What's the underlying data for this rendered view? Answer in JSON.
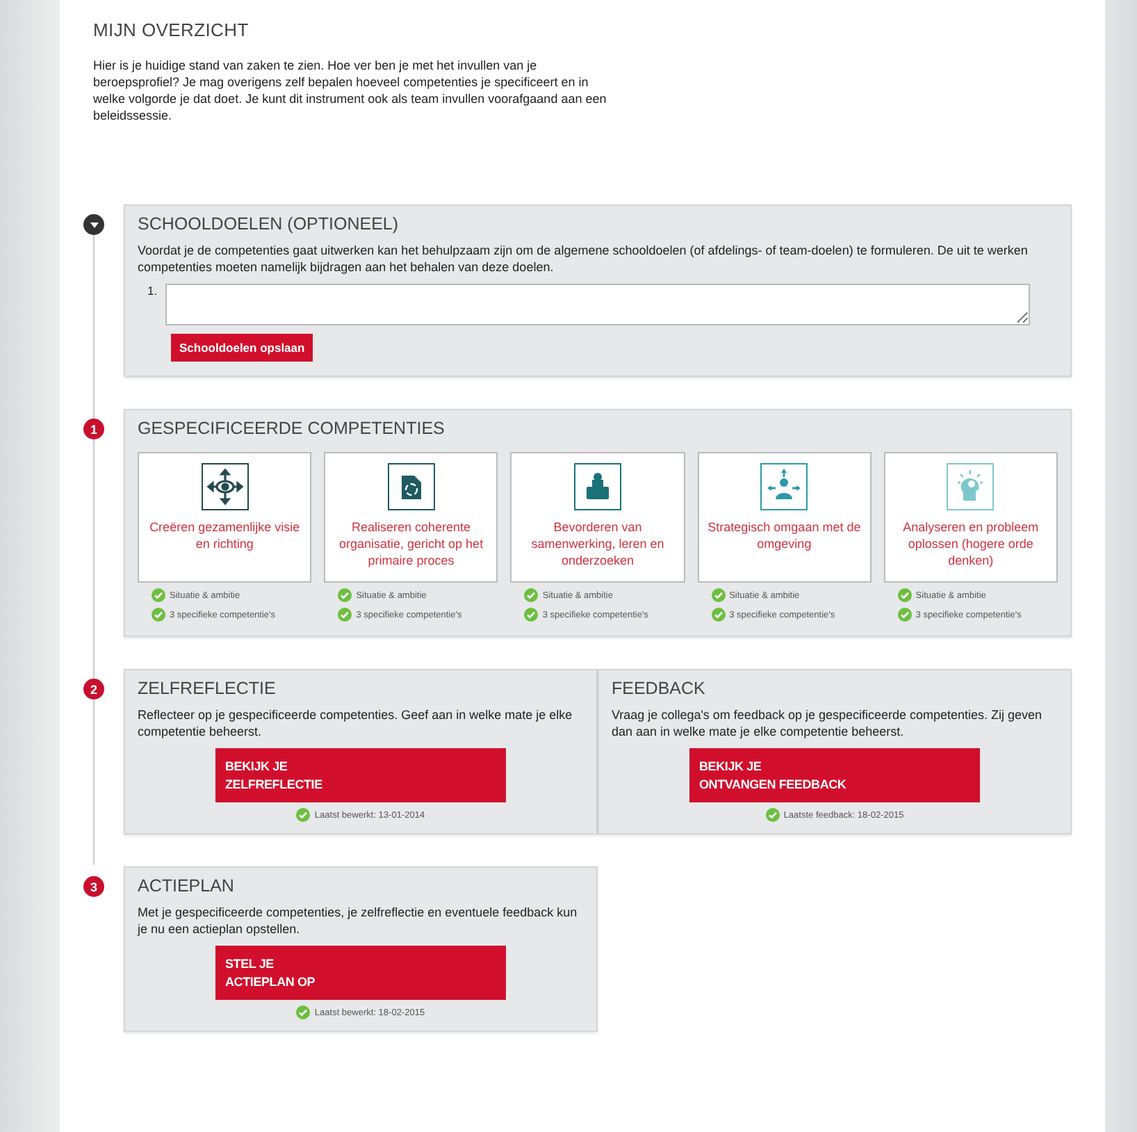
{
  "header": {
    "title": "MIJN OVERZICHT",
    "intro": "Hier is je huidige stand van zaken te zien. Hoe ver ben je met het invullen van je beroepsprofiel? Je mag overigens zelf bepalen hoeveel competenties je specificeert en in welke volgorde je dat doet. Je kunt dit instrument ook als team invullen voorafgaand aan een beleidssessie."
  },
  "sections": [
    {
      "kind": "goals",
      "marker": {
        "kind": "toggle"
      },
      "title": "SCHOOLDOELEN (OPTIONEEL)",
      "text": "Voordat je de competenties gaat uitwerken kan het behulpzaam zijn om de algemene schooldoelen (of afdelings- of team-doelen) te formuleren. De uit te werken competenties moeten namelijk bijdragen aan het behalen van deze doelen.",
      "goals": [
        {
          "number": "1."
        }
      ],
      "button": "Schooldoelen opslaan"
    },
    {
      "kind": "competencies",
      "marker": {
        "kind": "number",
        "text": "1"
      },
      "title": "GESPECIFICEERDE COMPETENTIES",
      "competencies": [
        {
          "title": "Creëren gezamenlijke visie en richting",
          "color": "#264a4e",
          "statuses": [
            {
              "text": "Situatie & ambitie",
              "done": true
            },
            {
              "text": "3 specifieke competentie's",
              "done": true
            }
          ]
        },
        {
          "title": "Realiseren coherente organisatie, gericht op het primaire proces",
          "color": "#1f5a60",
          "statuses": [
            {
              "text": "Situatie & ambitie",
              "done": true
            },
            {
              "text": "3 specifieke competentie's",
              "done": true
            }
          ]
        },
        {
          "title": "Bevorderen van samenwerking, leren en onderzoeken",
          "color": "#1a7178",
          "statuses": [
            {
              "text": "Situatie & ambitie",
              "done": true
            },
            {
              "text": "3 specifieke competentie's",
              "done": true
            }
          ]
        },
        {
          "title": "Strategisch omgaan met de omgeving",
          "color": "#2a9aa5",
          "statuses": [
            {
              "text": "Situatie & ambitie",
              "done": true
            },
            {
              "text": "3 specifieke competentie's",
              "done": true
            }
          ]
        },
        {
          "title": "Analyseren en probleem oplossen (hogere orde denken)",
          "color": "#7cc7cc",
          "statuses": [
            {
              "text": "Situatie & ambitie",
              "done": true
            },
            {
              "text": "3 specifieke competentie's",
              "done": true
            }
          ]
        }
      ]
    },
    {
      "kind": "split",
      "marker": {
        "kind": "number",
        "text": "2"
      },
      "panels": [
        {
          "title": "ZELFREFLECTIE",
          "text": "Reflecteer op je gespecificeerde competenties. Geef aan in welke mate je elke competentie beheerst.",
          "button": "BEKIJK JE\nZELFREFLECTIE",
          "status": {
            "text": "Laatst bewerkt: 13-01-2014",
            "done": true
          }
        },
        {
          "title": "FEEDBACK",
          "text": "Vraag je collega's om feedback op je gespecificeerde competenties. Zij geven dan aan in welke mate je elke competentie beheerst.",
          "button": "BEKIJK JE\nONTVANGEN FEEDBACK",
          "status": {
            "text": "Laatste feedback: 18-02-2015",
            "done": true
          }
        }
      ]
    },
    {
      "kind": "split",
      "marker": {
        "kind": "number",
        "text": "3"
      },
      "panels": [
        {
          "title": "ACTIEPLAN",
          "text": "Met je gespecificeerde competenties, je zelfreflectie en eventuele feedback kun je nu een actieplan opstellen.",
          "button": "STEL JE\nACTIEPLAN OP",
          "status": {
            "text": "Laatst bewerkt: 18-02-2015",
            "done": true
          }
        }
      ]
    }
  ]
}
